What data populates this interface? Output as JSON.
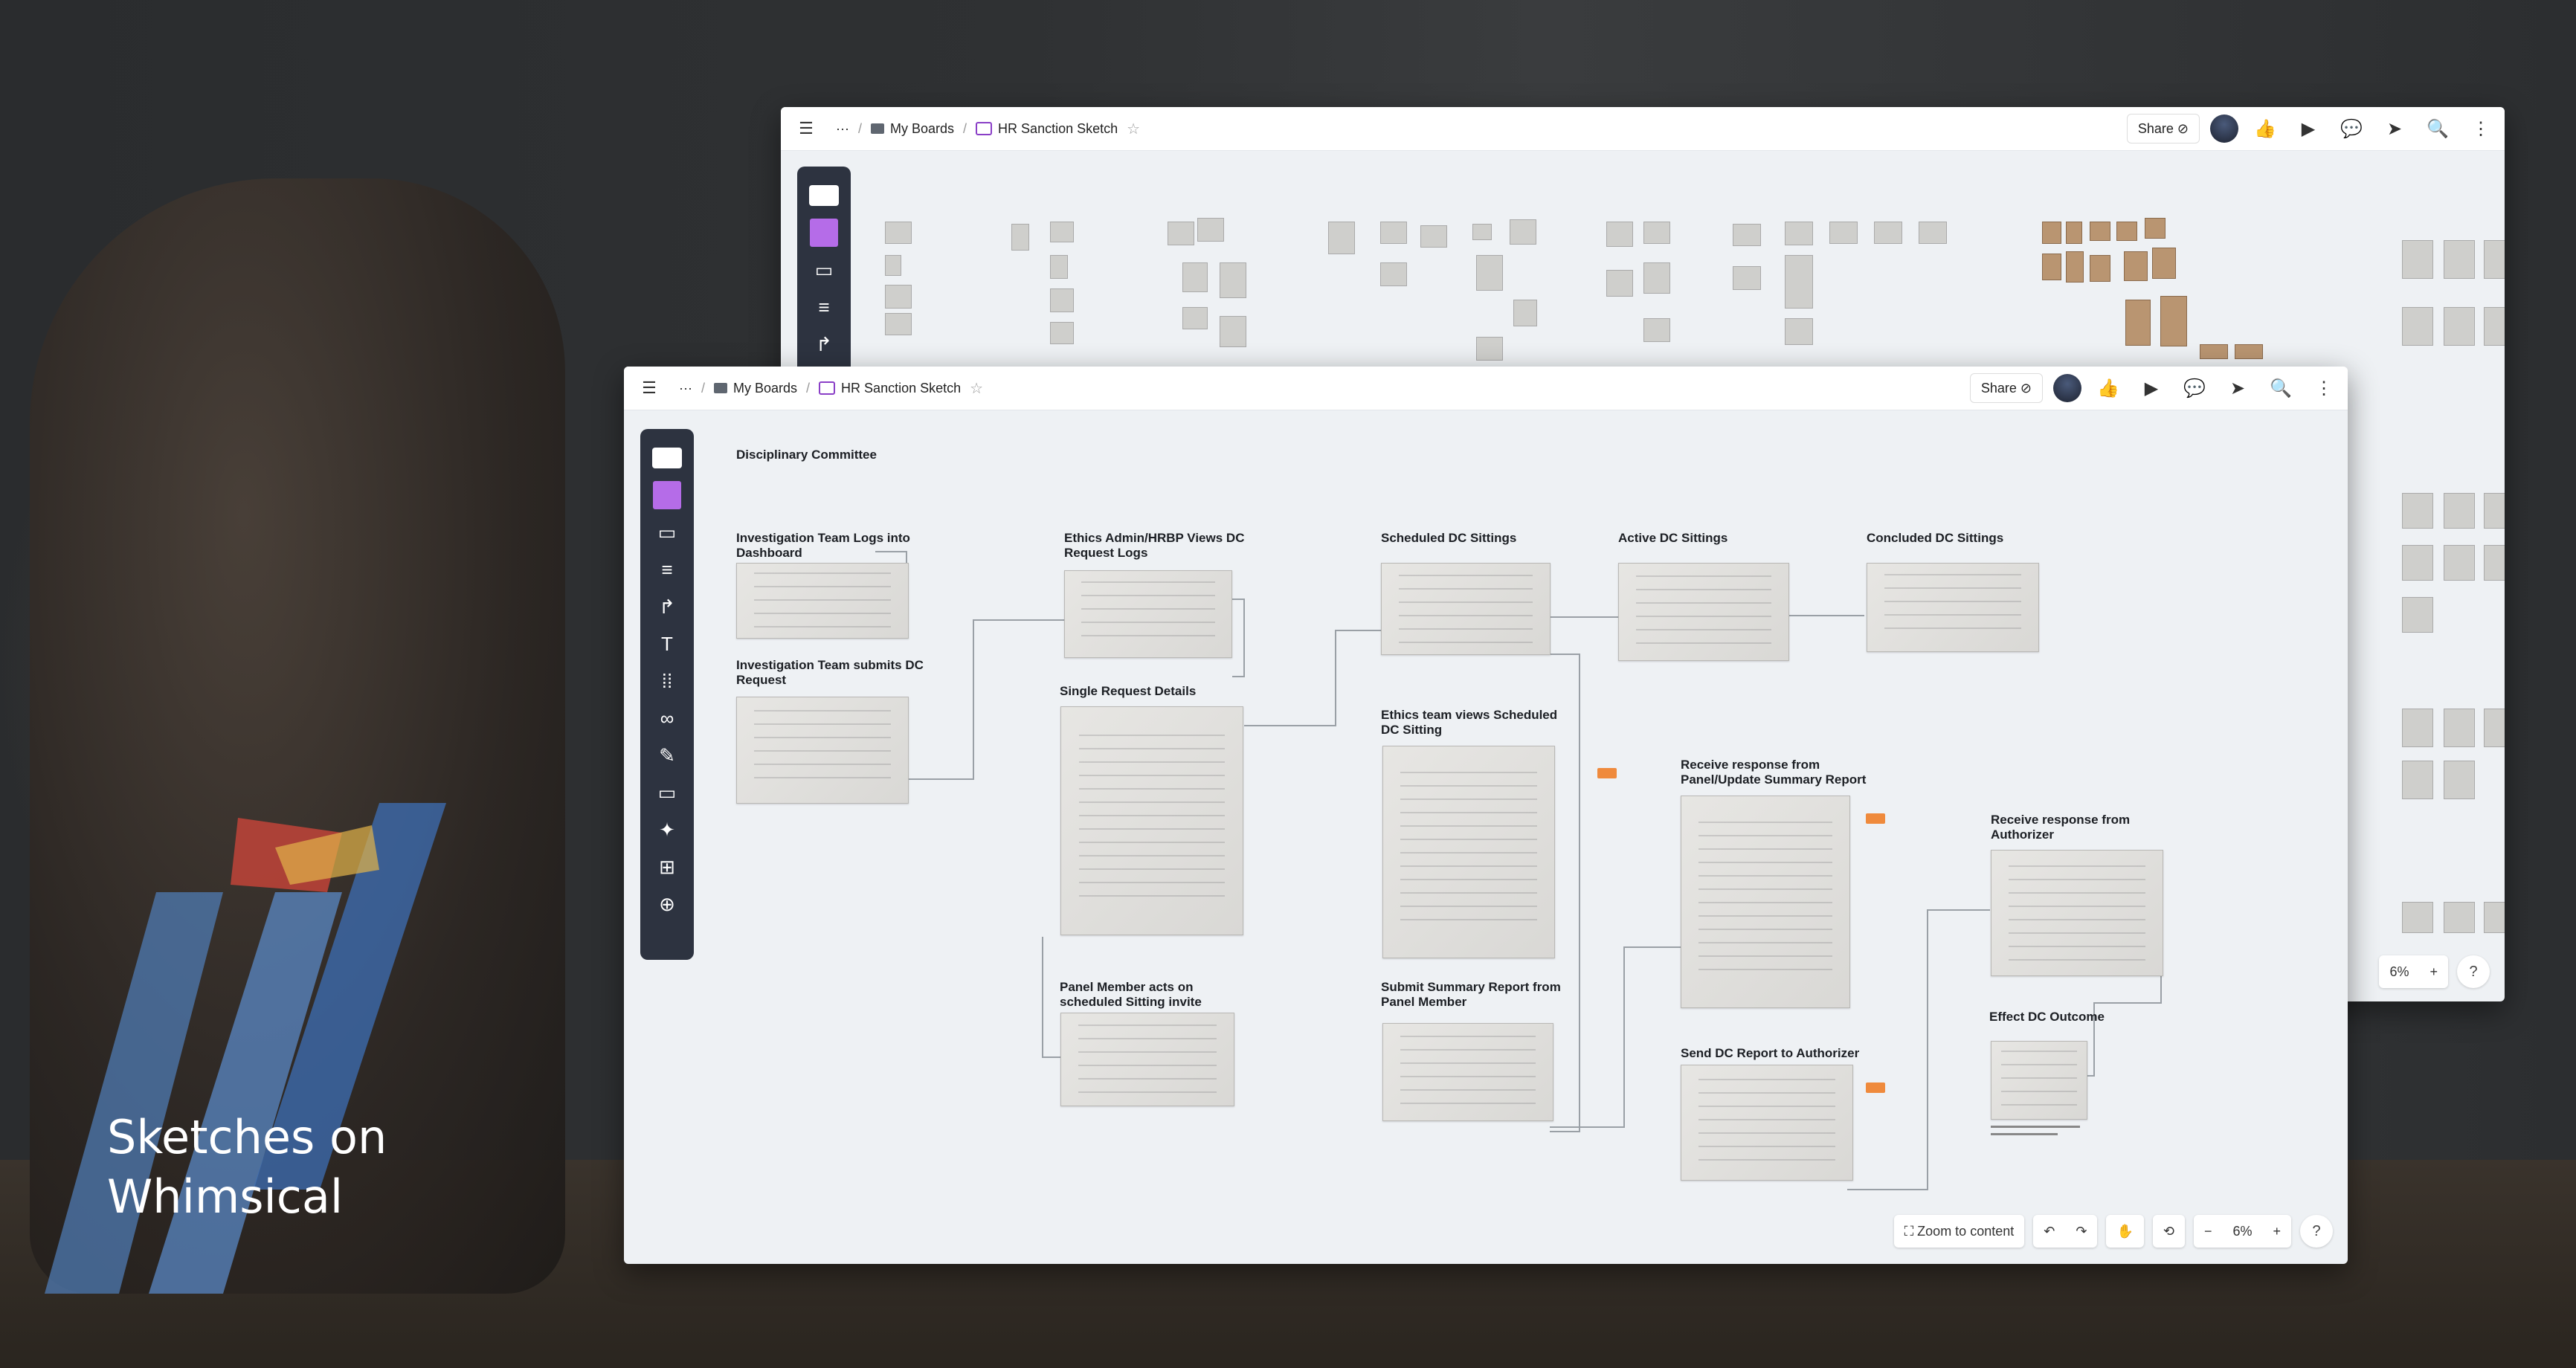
{
  "hero": {
    "line1": "Sketches on",
    "line2": "Whimsical"
  },
  "back_window": {
    "breadcrumb": {
      "ellipsis": "···",
      "folder": "My Boards",
      "board": "HR Sanction Sketch"
    },
    "share_label": "Share",
    "zoom": "6%",
    "help": "?",
    "plus": "+"
  },
  "front_window": {
    "breadcrumb": {
      "ellipsis": "···",
      "folder": "My Boards",
      "board": "HR Sanction Sketch"
    },
    "share_label": "Share",
    "canvas_title": "Disciplinary Committee",
    "sections": [
      {
        "title": "Investigation Team Logs into Dashboard"
      },
      {
        "title": "Investigation Team submits DC Request"
      },
      {
        "title": "Ethics Admin/HRBP Views DC Request Logs"
      },
      {
        "title": "Single Request Details"
      },
      {
        "title": "Panel Member acts on scheduled Sitting invite"
      },
      {
        "title": "Scheduled DC Sittings"
      },
      {
        "title": "Active DC Sittings"
      },
      {
        "title": "Concluded DC Sittings"
      },
      {
        "title": "Ethics team views Scheduled DC Sitting"
      },
      {
        "title": "Submit Summary Report from Panel Member"
      },
      {
        "title": "Receive response from Panel/Update Summary Report"
      },
      {
        "title": "Send DC Report to Authorizer"
      },
      {
        "title": "Receive response from Authorizer"
      },
      {
        "title": "Effect DC Outcome"
      }
    ],
    "bottom": {
      "zoom_to_content": "Zoom to content",
      "undo": "↶",
      "redo": "↷",
      "hand": "✋",
      "history": "⟲",
      "zoom_out": "−",
      "zoom": "6%",
      "zoom_in": "+",
      "help": "?"
    }
  },
  "icons": {
    "menu": "☰",
    "star": "☆",
    "thumbs_up": "👍",
    "present": "▶",
    "comment": "💬",
    "send": "➤",
    "search": "🔍",
    "more": "⋮",
    "tools": [
      "✎",
      "↱",
      "T",
      "⋮⋮",
      "🔗",
      "✏",
      "▭",
      "✦",
      "⊞",
      "⊕"
    ]
  }
}
